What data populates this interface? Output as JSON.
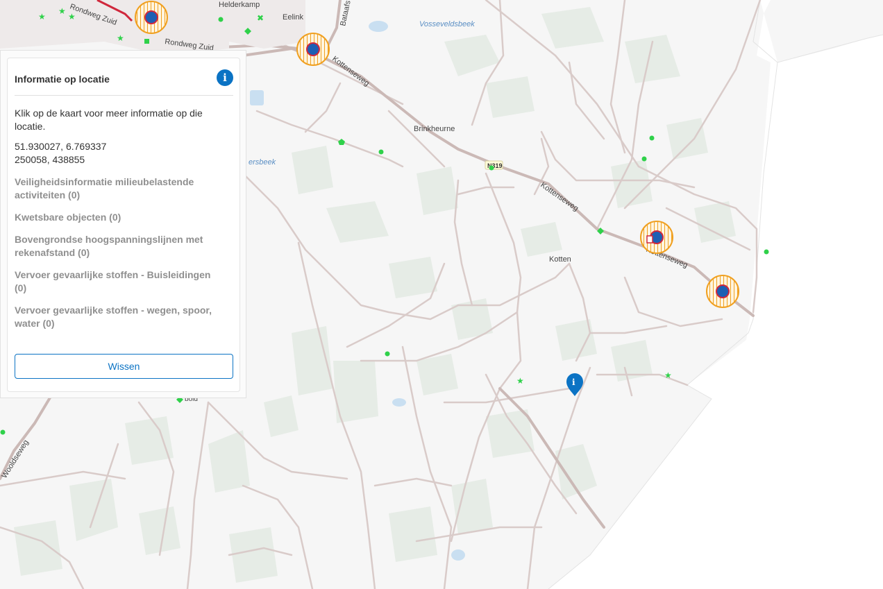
{
  "map": {
    "labels": {
      "helderkamp": "Helderkamp",
      "eelink": "Eelink",
      "bataafs": "Bataafs",
      "vosseveldsbeek": "Vosseveldsbeek",
      "rondweg_zuid_1": "Rondweg Zuid",
      "rondweg_zuid_2": "Rondweg Zuid",
      "kottenseweg_1": "Kottenseweg",
      "kottenseweg_2": "Kottenseweg",
      "kottenseweg_3": "Kottenseweg",
      "brinkheurne": "Brinkheurne",
      "ersbeek": "ersbeek",
      "n319": "N319",
      "kotten": "Kotten",
      "bold": "bold",
      "wooldseweg": "Wooldseweg"
    },
    "colors": {
      "road": "#d6c8c6",
      "road_main": "#cbb9b6",
      "field": "#e6ece6",
      "water": "#c9dff1",
      "water_label": "#5b8fc4",
      "point": "#2fd14a",
      "risk_ring": "#f0a020",
      "marker": "#0b73c4"
    }
  },
  "panel": {
    "title": "Informatie op locatie",
    "info_icon": "i",
    "intro": "Klik op de kaart voor meer informatie op die locatie.",
    "coord_wgs84": "51.930027, 6.769337",
    "coord_rd": "250058, 438855",
    "categories": [
      "Veiligheidsinformatie milieubelastende activiteiten (0)",
      "Kwetsbare objecten (0)",
      "Bovengrondse hoogspanningslijnen met rekenafstand (0)",
      "Vervoer gevaarlijke stoffen - Buisleidingen (0)",
      "Vervoer gevaarlijke stoffen - wegen, spoor, water (0)"
    ],
    "clear_button": "Wissen"
  },
  "location_marker": {
    "icon": "i"
  }
}
